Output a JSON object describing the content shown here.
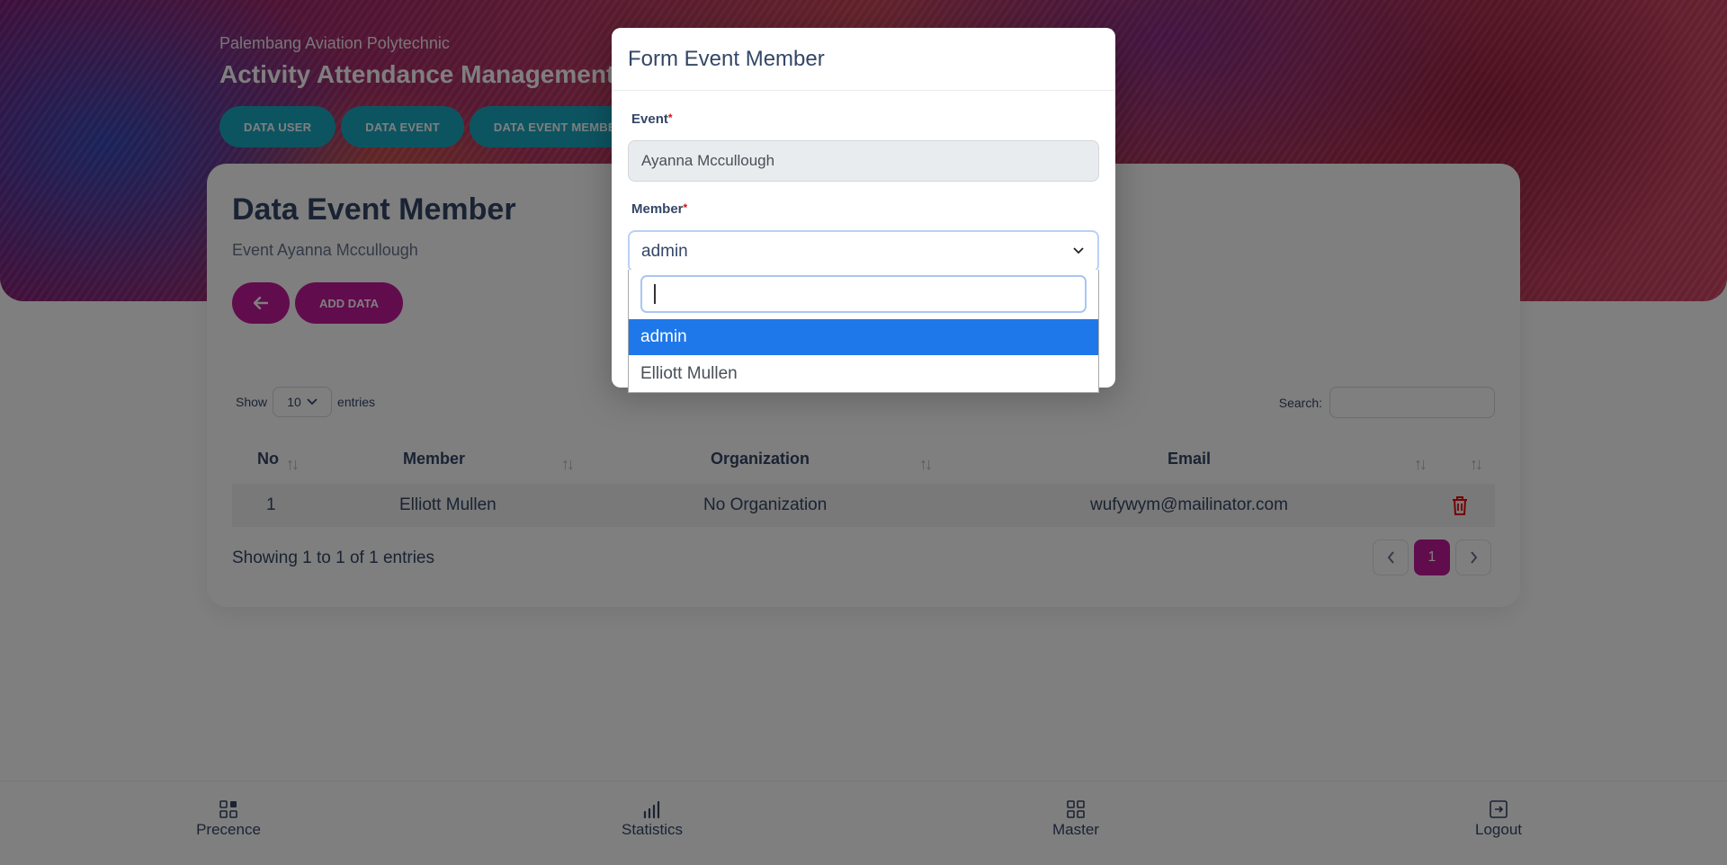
{
  "header": {
    "institution": "Palembang Aviation Polytechnic",
    "app_title": "Activity Attendance Management Ap",
    "nav": [
      "DATA USER",
      "DATA EVENT",
      "DATA EVENT MEMBER"
    ]
  },
  "card": {
    "title": "Data Event Member",
    "subtitle": "Event Ayanna Mccullough",
    "back_icon": "arrow-left-icon",
    "add_label": "ADD DATA",
    "length": {
      "show": "Show",
      "value": "10",
      "entries": "entries"
    },
    "search_label": "Search:",
    "columns": [
      "No",
      "Member",
      "Organization",
      "Email"
    ],
    "rows": [
      {
        "no": "1",
        "member": "Elliott Mullen",
        "organization": "No Organization",
        "email": "wufywym@mailinator.com"
      }
    ],
    "info": "Showing 1 to 1 of 1 entries",
    "pagination": {
      "current": "1"
    }
  },
  "bottom_nav": [
    {
      "label": "Precence",
      "icon": "grid-icon"
    },
    {
      "label": "Statistics",
      "icon": "bar-chart-icon"
    },
    {
      "label": "Master",
      "icon": "apps-icon"
    },
    {
      "label": "Logout",
      "icon": "logout-icon"
    }
  ],
  "modal": {
    "title": "Form Event Member",
    "event_label": "Event",
    "event_value": "Ayanna Mccullough",
    "member_label": "Member",
    "member_value": "admin",
    "required_mark": "*",
    "options": [
      "admin",
      "Elliott Mullen"
    ],
    "selected_option": "admin"
  },
  "colors": {
    "primary_pink": "#c2189a",
    "nav_cyan": "#1aa9c3",
    "option_highlight": "#1e78ea",
    "delete_red": "#ea0606"
  }
}
